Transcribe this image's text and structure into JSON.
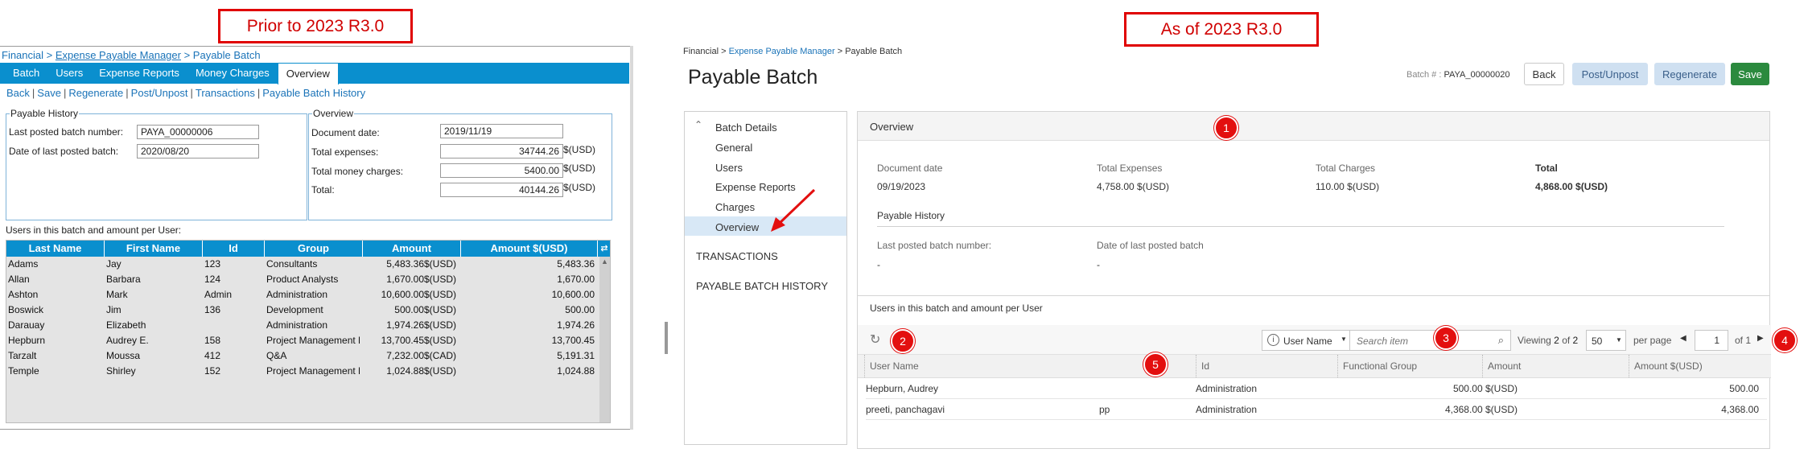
{
  "callouts": {
    "prior": "Prior to 2023 R3.0",
    "asof": "As of 2023 R3.0"
  },
  "old": {
    "breadcrumb": {
      "root": "Financial",
      "sep1": " > ",
      "middle": "Expense Payable Manager",
      "sep2": " > ",
      "current": "Payable Batch"
    },
    "tabs": [
      "Batch",
      "Users",
      "Expense Reports",
      "Money Charges",
      "Overview"
    ],
    "active_tab": "Overview",
    "links": [
      "Back",
      "Save",
      "Regenerate",
      "Post/Unpost",
      "Transactions",
      "Payable Batch History"
    ],
    "link_sep": "|",
    "payable_history": {
      "legend": "Payable History",
      "last_posted_label": "Last posted batch number:",
      "last_posted_value": "PAYA_00000006",
      "date_label": "Date of last posted batch:",
      "date_value": "2020/08/20"
    },
    "overview": {
      "legend": "Overview",
      "doc_date_label": "Document date:",
      "doc_date_value": "2019/11/19",
      "total_expenses_label": "Total expenses:",
      "total_expenses_value": "34744.26",
      "total_money_label": "Total money charges:",
      "total_money_value": "5400.00",
      "total_label": "Total:",
      "total_value": "40144.26",
      "currency": "$(USD)"
    },
    "users_caption": "Users in this batch and amount per User:",
    "table": {
      "headers": [
        "Last Name",
        "First Name",
        "Id",
        "Group",
        "Amount",
        "Amount $(USD)"
      ],
      "rows": [
        [
          "Adams",
          "Jay",
          "123",
          "Consultants",
          "5,483.36$(USD)",
          "5,483.36"
        ],
        [
          "Allan",
          "Barbara",
          "124",
          "Product Analysts",
          "1,670.00$(USD)",
          "1,670.00"
        ],
        [
          "Ashton",
          "Mark",
          "Admin",
          "Administration",
          "10,600.00$(USD)",
          "10,600.00"
        ],
        [
          "Boswick",
          "Jim",
          "136",
          "Development",
          "500.00$(USD)",
          "500.00"
        ],
        [
          "Darauay",
          "Elizabeth",
          "",
          "Administration",
          "1,974.26$(USD)",
          "1,974.26"
        ],
        [
          "Hepburn",
          "Audrey E.",
          "158",
          "Project Management E",
          "13,700.45$(USD)",
          "13,700.45"
        ],
        [
          "Tarzalt",
          "Moussa",
          "412",
          "Q&A",
          "7,232.00$(CAD)",
          "5,191.31"
        ],
        [
          "Temple",
          "Shirley",
          "152",
          "Project Management E",
          "1,024.88$(USD)",
          "1,024.88"
        ]
      ]
    }
  },
  "new": {
    "breadcrumb": {
      "root": "Financial",
      "sep1": " > ",
      "middle": "Expense Payable Manager",
      "sep2": " > ",
      "current": "Payable Batch"
    },
    "title": "Payable Batch",
    "batch_label": "Batch # :",
    "batch_value": "PAYA_00000020",
    "buttons": {
      "back": "Back",
      "post": "Post/Unpost",
      "regenerate": "Regenerate",
      "save": "Save"
    },
    "sidebar": {
      "section": "Batch Details",
      "items": [
        "General",
        "Users",
        "Expense Reports",
        "Charges",
        "Overview"
      ],
      "active": "Overview",
      "transactions": "TRANSACTIONS",
      "history": "PAYABLE BATCH HISTORY"
    },
    "overview": {
      "heading": "Overview",
      "doc_date_label": "Document date",
      "doc_date_value": "09/19/2023",
      "total_expenses_label": "Total Expenses",
      "total_expenses_value": "4,758.00 $(USD)",
      "total_charges_label": "Total Charges",
      "total_charges_value": "110.00 $(USD)",
      "total_label": "Total",
      "total_value": "4,868.00 $(USD)",
      "history_heading": "Payable History",
      "last_posted_label": "Last posted batch number:",
      "last_posted_value": "-",
      "date_label": "Date of last posted batch",
      "date_value": "-"
    },
    "users": {
      "heading": "Users in this batch and amount per User",
      "filter_field": "User Name",
      "search_placeholder": "Search item",
      "viewing_label": "Viewing",
      "viewing_count": "2",
      "viewing_of": "of",
      "viewing_total": "2",
      "per_page_value": "50",
      "per_page_label": "per page",
      "page_value": "1",
      "page_of": "of 1",
      "columns": [
        "User Name",
        "Id",
        "Functional Group",
        "Amount",
        "Amount $(USD)"
      ],
      "rows": [
        [
          "Hepburn, Audrey",
          "",
          "Administration",
          "500.00 $(USD)",
          "500.00"
        ],
        [
          "preeti, panchagavi",
          "pp",
          "Administration",
          "4,368.00 $(USD)",
          "4,368.00"
        ]
      ]
    },
    "badges": [
      "1",
      "2",
      "3",
      "4",
      "5"
    ]
  },
  "colors": {
    "old_blue": "#0a8fce",
    "save_green": "#2b8a3e",
    "light_button": "#cfe0f1",
    "badge_red": "#e30f0f"
  }
}
